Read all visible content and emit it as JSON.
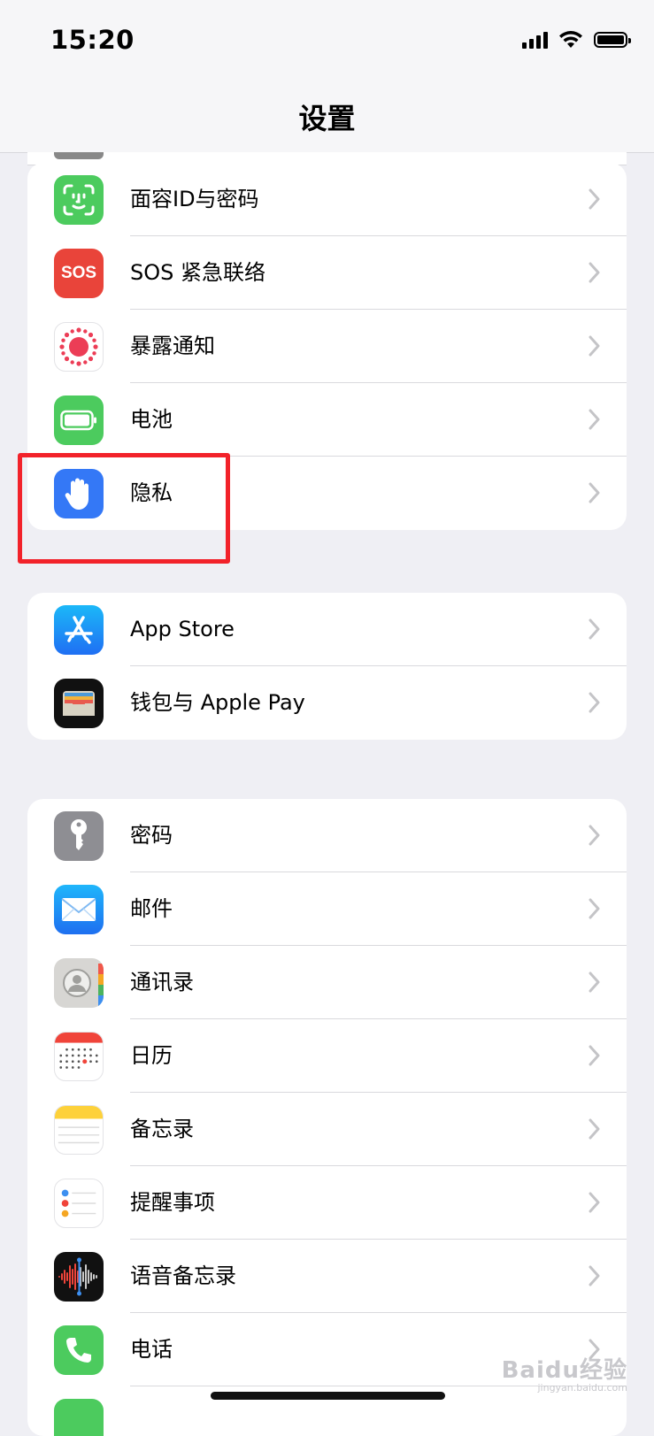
{
  "status": {
    "time": "15:20"
  },
  "nav": {
    "title": "设置"
  },
  "groups": [
    {
      "items": [
        {
          "label": "面容ID与密码",
          "icon": "face-id-icon",
          "color": "#4ccb5e"
        },
        {
          "label": "SOS 紧急联络",
          "icon": "sos-icon",
          "color": "#e9443a",
          "icon_text": "SOS"
        },
        {
          "label": "暴露通知",
          "icon": "exposure-notification-icon",
          "color": "#ffffff"
        },
        {
          "label": "电池",
          "icon": "battery-icon",
          "color": "#4ccb5e"
        },
        {
          "label": "隐私",
          "icon": "privacy-hand-icon",
          "color": "#3478f6"
        }
      ]
    },
    {
      "items": [
        {
          "label": "App Store",
          "icon": "app-store-icon",
          "color": "#2f8ef7"
        },
        {
          "label": "钱包与 Apple Pay",
          "icon": "wallet-icon",
          "color": "#111111"
        }
      ]
    },
    {
      "items": [
        {
          "label": "密码",
          "icon": "key-icon",
          "color": "#8e8e93"
        },
        {
          "label": "邮件",
          "icon": "mail-icon",
          "color": "#2d8cf7"
        },
        {
          "label": "通讯录",
          "icon": "contacts-icon",
          "color": "#d7d6d3"
        },
        {
          "label": "日历",
          "icon": "calendar-icon",
          "color": "#ffffff"
        },
        {
          "label": "备忘录",
          "icon": "notes-icon",
          "color": "#ffffff"
        },
        {
          "label": "提醒事项",
          "icon": "reminders-icon",
          "color": "#ffffff"
        },
        {
          "label": "语音备忘录",
          "icon": "voice-memos-icon",
          "color": "#111111"
        },
        {
          "label": "电话",
          "icon": "phone-icon",
          "color": "#4ccb5e"
        }
      ]
    }
  ],
  "highlight_color": "#f2222a",
  "watermark": {
    "text": "Baidu经验",
    "sub": "jingyan.baidu.com"
  }
}
